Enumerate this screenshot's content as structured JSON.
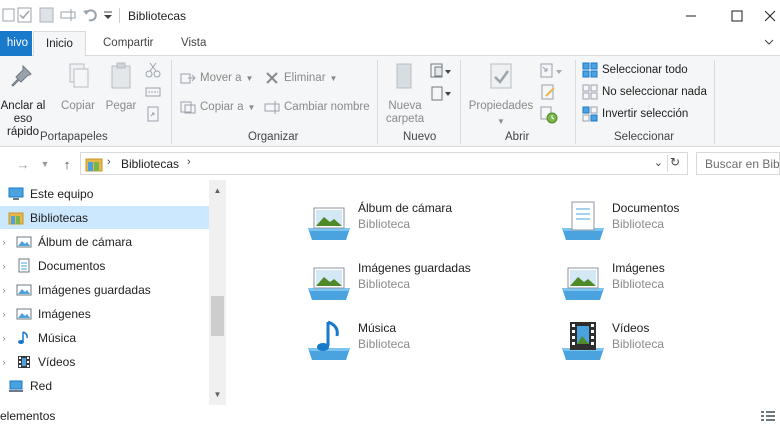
{
  "window": {
    "title": "Bibliotecas"
  },
  "tabs": [
    {
      "label": "hivo"
    },
    {
      "label": "Inicio"
    },
    {
      "label": "Compartir"
    },
    {
      "label": "Vista"
    }
  ],
  "ribbon": {
    "portapapeles": {
      "label": "Portapapeles",
      "pin_line1": "Anclar al",
      "pin_line2": "eso rápido",
      "copy": "Copiar",
      "paste": "Pegar"
    },
    "organizar": {
      "label": "Organizar",
      "move": "Mover a",
      "copy_to": "Copiar a",
      "delete": "Eliminar",
      "rename": "Cambiar nombre"
    },
    "nuevo": {
      "label": "Nuevo",
      "new_folder_line1": "Nueva",
      "new_folder_line2": "carpeta"
    },
    "abrir": {
      "label": "Abrir",
      "properties": "Propiedades"
    },
    "seleccionar": {
      "label": "Seleccionar",
      "select_all": "Seleccionar todo",
      "select_none": "No seleccionar nada",
      "invert": "Invertir selección"
    }
  },
  "address": {
    "crumb": "Bibliotecas",
    "search_placeholder": "Buscar en Bibliotecas"
  },
  "nav_tree": [
    {
      "label": "Este equipo",
      "icon": "pc-icon"
    },
    {
      "label": "Bibliotecas",
      "icon": "libraries-icon",
      "selected": true
    },
    {
      "label": "Álbum de cámara",
      "icon": "image-library-icon"
    },
    {
      "label": "Documentos",
      "icon": "documents-library-icon"
    },
    {
      "label": "Imágenes guardadas",
      "icon": "image-library-icon"
    },
    {
      "label": "Imágenes",
      "icon": "image-library-icon"
    },
    {
      "label": "Música",
      "icon": "music-library-icon"
    },
    {
      "label": "Vídeos",
      "icon": "video-library-icon"
    },
    {
      "label": "Red",
      "icon": "network-icon"
    }
  ],
  "libraries": [
    {
      "name": "Álbum de cámara",
      "type": "Biblioteca"
    },
    {
      "name": "Documentos",
      "type": "Biblioteca"
    },
    {
      "name": "Imágenes guardadas",
      "type": "Biblioteca"
    },
    {
      "name": "Imágenes",
      "type": "Biblioteca"
    },
    {
      "name": "Música",
      "type": "Biblioteca"
    },
    {
      "name": "Vídeos",
      "type": "Biblioteca"
    }
  ],
  "status": {
    "text": "elementos"
  },
  "colors": {
    "accent": "#1979ca",
    "selection": "#cce8ff",
    "folder": "#e8b74a",
    "library_blue": "#4aa3df"
  }
}
